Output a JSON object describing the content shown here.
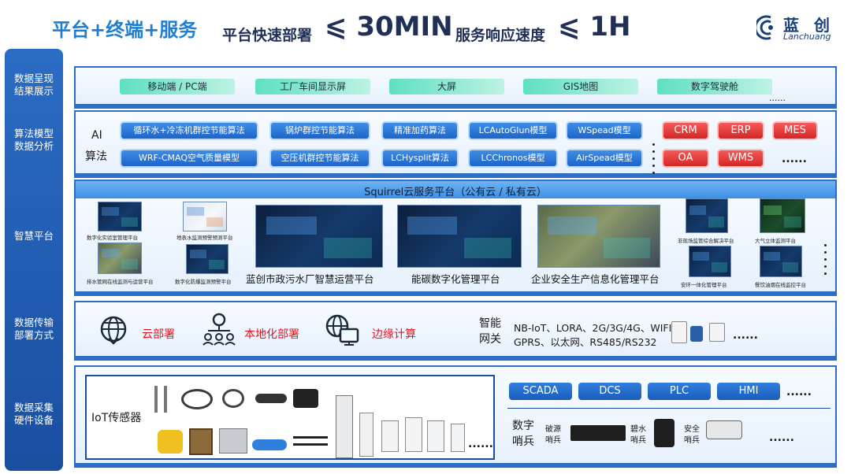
{
  "header": {
    "title": "平台+终端+服务",
    "deploy_label": "平台快速部署",
    "deploy_value": "⩽ 30MIN",
    "response_label": "服务响应速度",
    "response_value": "⩽ 1H"
  },
  "logo": {
    "name_cn": "蓝 创",
    "name_en": "Lanchuang"
  },
  "left_labels": [
    "数据呈现\n结果展示",
    "算法模型\n数据分析",
    "智慧平台",
    "数据传输\n部署方式",
    "数据采集\n硬件设备"
  ],
  "display_layer": {
    "items": [
      "移动端 / PC端",
      "工厂车间显示屏",
      "大屏",
      "GIS地图",
      "数字驾驶舱"
    ],
    "more": "......"
  },
  "algo_layer": {
    "label_line1": "AI",
    "label_line2": "算法",
    "row1": [
      "循环水+冷冻机群控节能算法",
      "锅炉群控节能算法",
      "精准加药算法",
      "LCAutoGlun模型",
      "WSpead模型"
    ],
    "row2": [
      "WRF-CMAQ空气质量模型",
      "空压机群控节能算法",
      "LCHysplit算法",
      "LCChronos模型",
      "AirSpead模型"
    ],
    "systems_row1": [
      "CRM",
      "ERP",
      "MES"
    ],
    "systems_row2": [
      "OA",
      "WMS"
    ],
    "more": "......"
  },
  "platform_layer": {
    "title": "Squirrel云服务平台（公有云 / 私有云）",
    "small_left": [
      "数字化实验室管理平台",
      "地表水监测预警预测平台",
      "排水管网在线监测与运营平台",
      "数字化防爆监测预警平台"
    ],
    "main": [
      "蓝创市政污水厂智慧运营平台",
      "能碳数字化管理平台",
      "企业安全生产信息化管理平台"
    ],
    "small_right": [
      "非现场监管综合解决平台",
      "大气立体监测平台",
      "安环一体化管理平台",
      "餐饮油烟在线监控平台"
    ]
  },
  "transport_layer": {
    "modes": [
      "云部署",
      "本地化部署",
      "边缘计算"
    ],
    "icons": [
      "globe-icon",
      "org-chart-icon",
      "edge-computing-icon"
    ],
    "gateway_label_line1": "智能",
    "gateway_label_line2": "网关",
    "protocols_line1": "NB-IoT、LORA、2G/3G/4G、WIFI",
    "protocols_line2": "GPRS、以太网、RS485/RS232",
    "more": "......"
  },
  "hardware_layer": {
    "iot_label": "IoT传感器",
    "more_left": "......",
    "controls": [
      "SCADA",
      "DCS",
      "PLC",
      "HMI"
    ],
    "controls_more": "......",
    "sentinel_label_line1": "数字",
    "sentinel_label_line2": "哨兵",
    "sentinels": [
      {
        "line1": "破源",
        "line2": "哨兵"
      },
      {
        "line1": "碧水",
        "line2": "哨兵"
      },
      {
        "line1": "安全",
        "line2": "哨兵"
      }
    ],
    "sentinel_more": "......"
  },
  "colors": {
    "brand_blue": "#1f7fd3",
    "navy": "#1f2f55",
    "layer_border": "#2c6fc4",
    "system_red": "#e03030",
    "mode_red": "#e0141e"
  }
}
